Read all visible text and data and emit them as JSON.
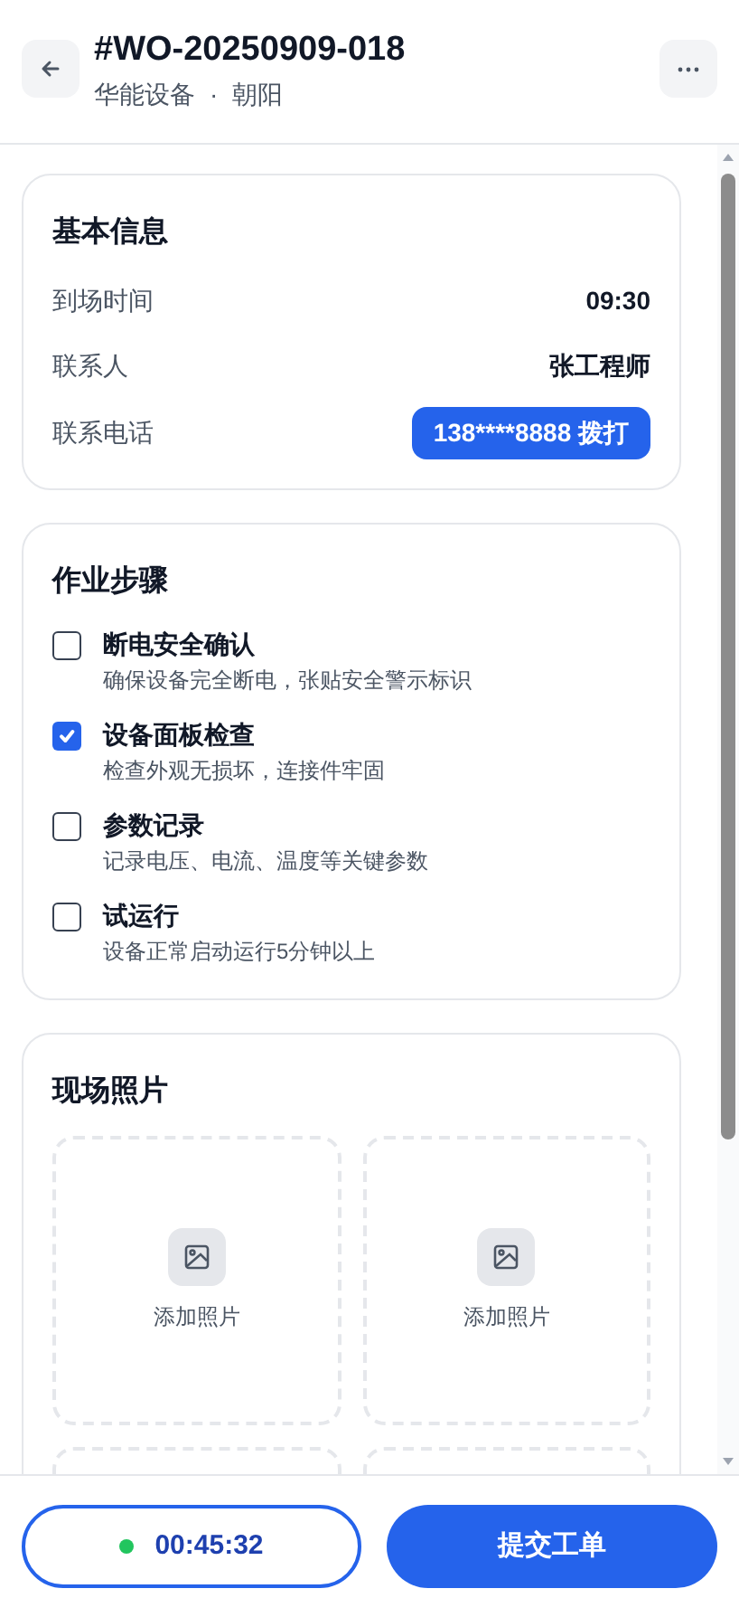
{
  "header": {
    "title": "#WO-20250909-018",
    "company": "华能设备",
    "separator": "·",
    "district": "朝阳"
  },
  "basic_info": {
    "title": "基本信息",
    "rows": [
      {
        "kind": "text",
        "label": "到场时间",
        "value": "09:30"
      },
      {
        "kind": "text",
        "label": "联系人",
        "value": "张工程师"
      },
      {
        "kind": "call",
        "label": "联系电话",
        "value": "138****8888 拨打"
      }
    ]
  },
  "steps": {
    "title": "作业步骤",
    "items": [
      {
        "title": "断电安全确认",
        "description": "确保设备完全断电，张贴安全警示标识",
        "checked": false
      },
      {
        "title": "设备面板检查",
        "description": "检查外观无损坏，连接件牢固",
        "checked": true
      },
      {
        "title": "参数记录",
        "description": "记录电压、电流、温度等关键参数",
        "checked": false
      },
      {
        "title": "试运行",
        "description": "设备正常启动运行5分钟以上",
        "checked": false
      }
    ]
  },
  "photos": {
    "title": "现场照片",
    "slots": [
      {
        "kind": "add",
        "label": "添加照片"
      },
      {
        "kind": "add",
        "label": "添加照片"
      },
      {
        "kind": "empty"
      },
      {
        "kind": "empty"
      }
    ]
  },
  "footer": {
    "timer": {
      "value": "00:45:32",
      "running": true
    },
    "submit": "提交工单"
  }
}
